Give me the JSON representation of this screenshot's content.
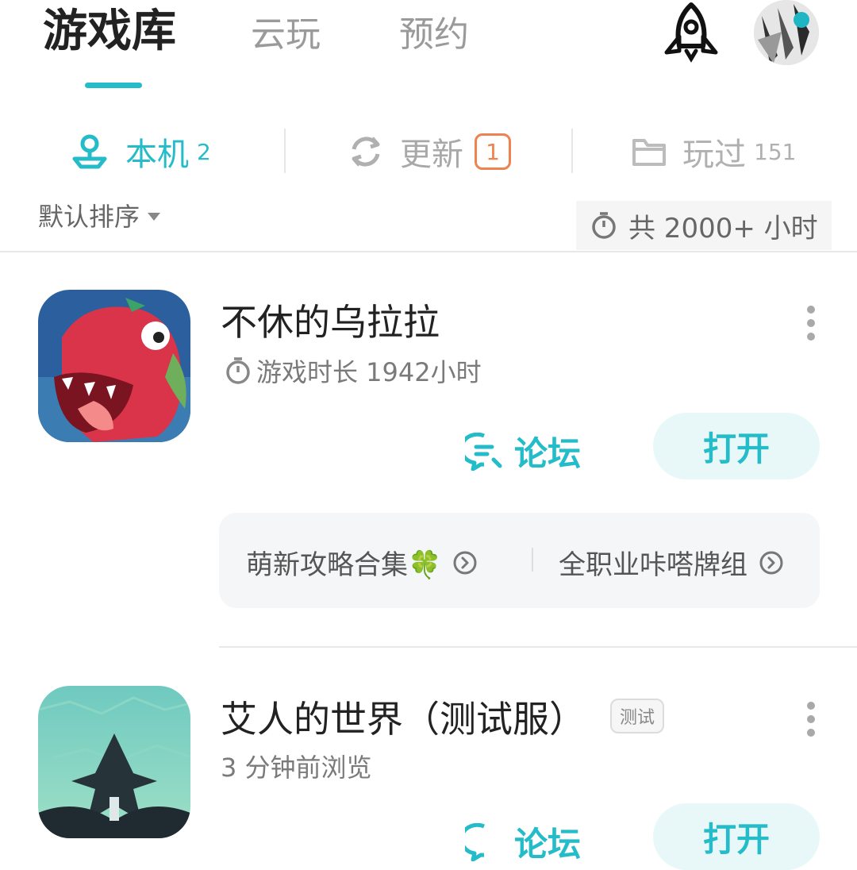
{
  "top_tabs": [
    "游戏库",
    "云玩",
    "预约"
  ],
  "sub_tabs": [
    {
      "label": "本机",
      "count": "2"
    },
    {
      "label": "更新",
      "count": "1"
    },
    {
      "label": "玩过",
      "count": "151"
    }
  ],
  "sort_label": "默认排序",
  "total_time": "共 2000+ 小时",
  "games": [
    {
      "title": "不休的乌拉拉",
      "meta": "游戏时长 1942小时",
      "forum_label": "论坛",
      "open_label": "打开",
      "guides": [
        "萌新攻略合集🍀",
        "全职业咔嗒牌组"
      ]
    },
    {
      "title": "艾人的世界（测试服）",
      "tag": "测试",
      "meta": "3 分钟前浏览",
      "forum_label": "论坛",
      "open_label": "打开"
    }
  ],
  "colors": {
    "accent": "#25bcc9",
    "update_badge": "#ee8250",
    "inactive": "#9a9a9a"
  },
  "icons": [
    "rocket-icon",
    "avatar",
    "location-pin-icon",
    "refresh-icon",
    "folder-icon",
    "timer-icon",
    "chat-bubble-icon",
    "chevron-right-circle-icon",
    "more-vertical-icon"
  ]
}
